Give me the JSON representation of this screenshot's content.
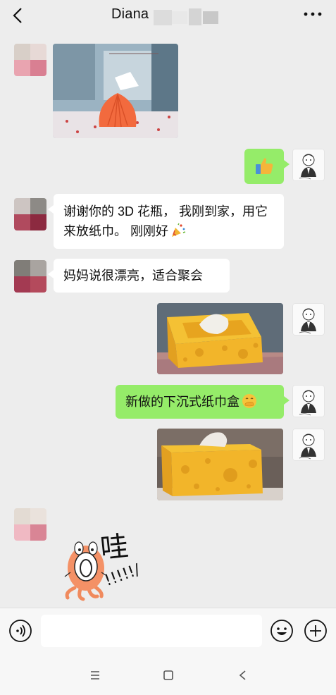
{
  "header": {
    "title": "Diana",
    "back_icon": "chevron-left-icon",
    "more_icon": "more-dots-icon"
  },
  "messages": [
    {
      "id": "m1",
      "side": "in",
      "type": "image",
      "description": "white-icon"
    },
    {
      "id": "m2",
      "side": "out",
      "type": "emoji",
      "emoji": "thumbs-up-icon"
    },
    {
      "id": "m3",
      "side": "in",
      "type": "text",
      "text": "谢谢你的 3D 花瓶， 我刚到家，用它来放纸巾。 刚刚好",
      "emoji": "party-popper-icon"
    },
    {
      "id": "m4",
      "side": "in",
      "type": "text",
      "text": "妈妈说很漂亮，适合聚会"
    },
    {
      "id": "m5",
      "side": "out",
      "type": "image",
      "description": "cheese-tissue-box"
    },
    {
      "id": "m6",
      "side": "out",
      "type": "text",
      "text": "新做的下沉式纸巾盒",
      "emoji": "hand-over-mouth-emoji-icon"
    },
    {
      "id": "m7",
      "side": "out",
      "type": "image",
      "description": "cheese-tissue-box"
    },
    {
      "id": "m8",
      "side": "in",
      "type": "sticker",
      "text": "哇",
      "subtext": "!!!!!/"
    }
  ],
  "input": {
    "placeholder": "",
    "voice_icon": "voice-icon",
    "emoji_icon": "emoji-face-icon",
    "plus_icon": "plus-circle-icon"
  },
  "system_nav": {
    "menu_icon": "menu-icon",
    "home_icon": "home-square-icon",
    "back_icon": "back-triangle-icon"
  },
  "colors": {
    "background": "#ededed",
    "bubble_out": "#95ec69",
    "bubble_in": "#ffffff",
    "cheese": "#f2b52a"
  }
}
